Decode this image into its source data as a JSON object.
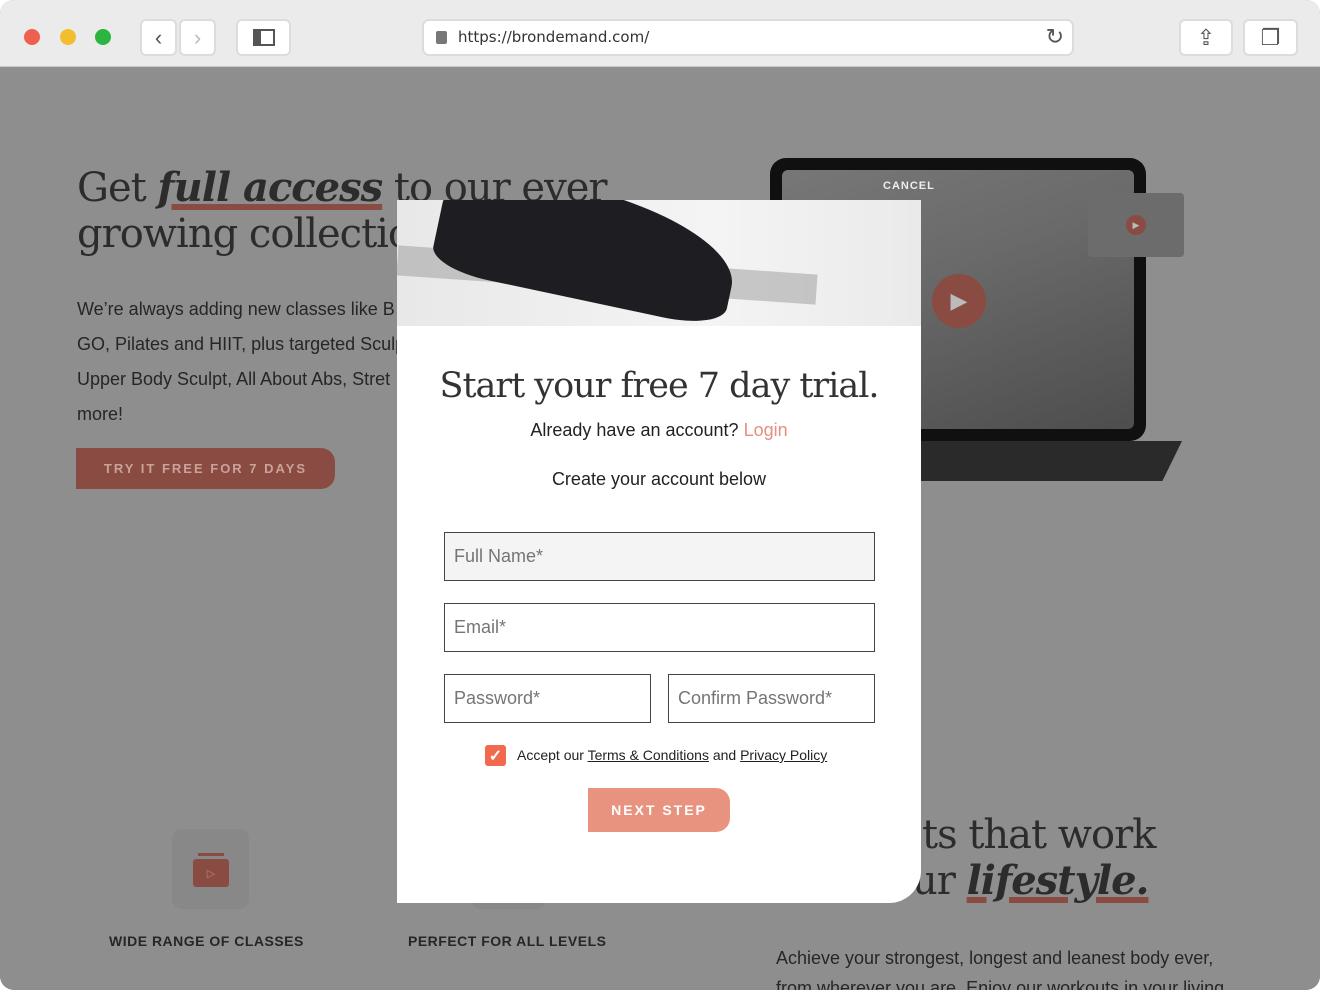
{
  "browser": {
    "url": "https://brondemand.com/",
    "traffic_colors": [
      "#f0604f",
      "#f2be2f",
      "#2bb540"
    ]
  },
  "hero": {
    "title_pre": "Get ",
    "title_em": "full access",
    "title_post": " to our ever",
    "title_line2": "growing collectio",
    "para_lines": [
      "We’re always adding new classes like B",
      "GO, Pilates and HIIT, plus targeted Sculp",
      "Upper Body Sculpt, All About Abs, Stret",
      "more!"
    ],
    "cta": "TRY IT FREE FOR 7 DAYS"
  },
  "device": {
    "cancel": "CANCEL"
  },
  "features": [
    {
      "label": "WIDE RANGE OF CLASSES"
    },
    {
      "label": "PERFECT FOR ALL LEVELS"
    }
  ],
  "section2": {
    "line1": "ts that work",
    "line2_pre": "ur ",
    "line2_em": "lifestyle.",
    "para_lines": [
      "Achieve your strongest, longest and leanest body ever,",
      "from wherever you are. Enjoy our workouts in your living"
    ]
  },
  "modal": {
    "title": "Start your free 7 day trial.",
    "have_account": "Already have an account?",
    "login": "Login",
    "create": "Create your account below",
    "fields": {
      "full_name": "Full Name*",
      "email": "Email*",
      "password": "Password*",
      "confirm": "Confirm Password*"
    },
    "accept_pre": "Accept our ",
    "terms": "Terms & Conditions",
    "and": " and ",
    "privacy": "Privacy Policy",
    "accepted": true,
    "next": "NEXT STEP",
    "accent": "#e8937f"
  }
}
